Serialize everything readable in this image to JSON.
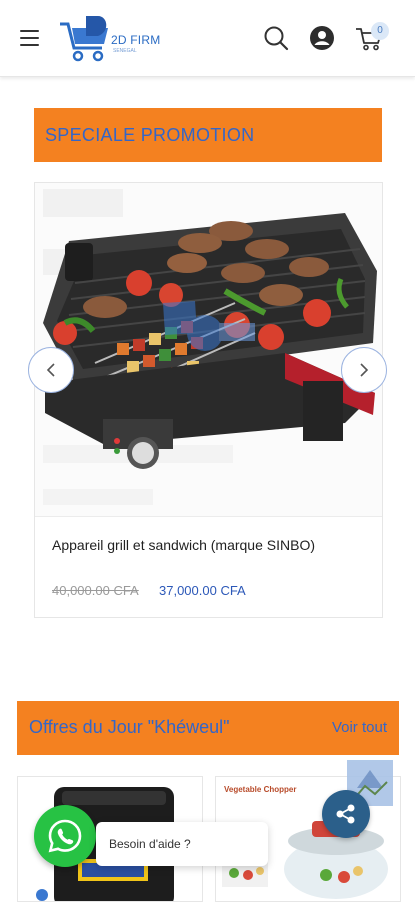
{
  "header": {
    "logo_text": "2D FIRM",
    "logo_sub": "SENEGAL",
    "icons": [
      "menu-icon",
      "search-icon",
      "account-icon",
      "cart-icon"
    ],
    "cart_count": "0"
  },
  "promo": {
    "title": "SPECIALE PROMOTION",
    "product": {
      "name": "Appareil grill et sandwich (marque SINBO)",
      "old_price": "40,000.00 CFA",
      "new_price": "37,000.00 CFA"
    }
  },
  "deals": {
    "title": "Offres du Jour \"Khéweul\"",
    "link": "Voir tout",
    "right_caption": "Vegetable Chopper"
  },
  "help": {
    "text": "Besoin d'aide ?"
  },
  "colors": {
    "accent_orange": "#f48120",
    "brand_blue": "#3466c8",
    "whatsapp_green": "#27c244",
    "share_blue": "#2b5f8a"
  }
}
